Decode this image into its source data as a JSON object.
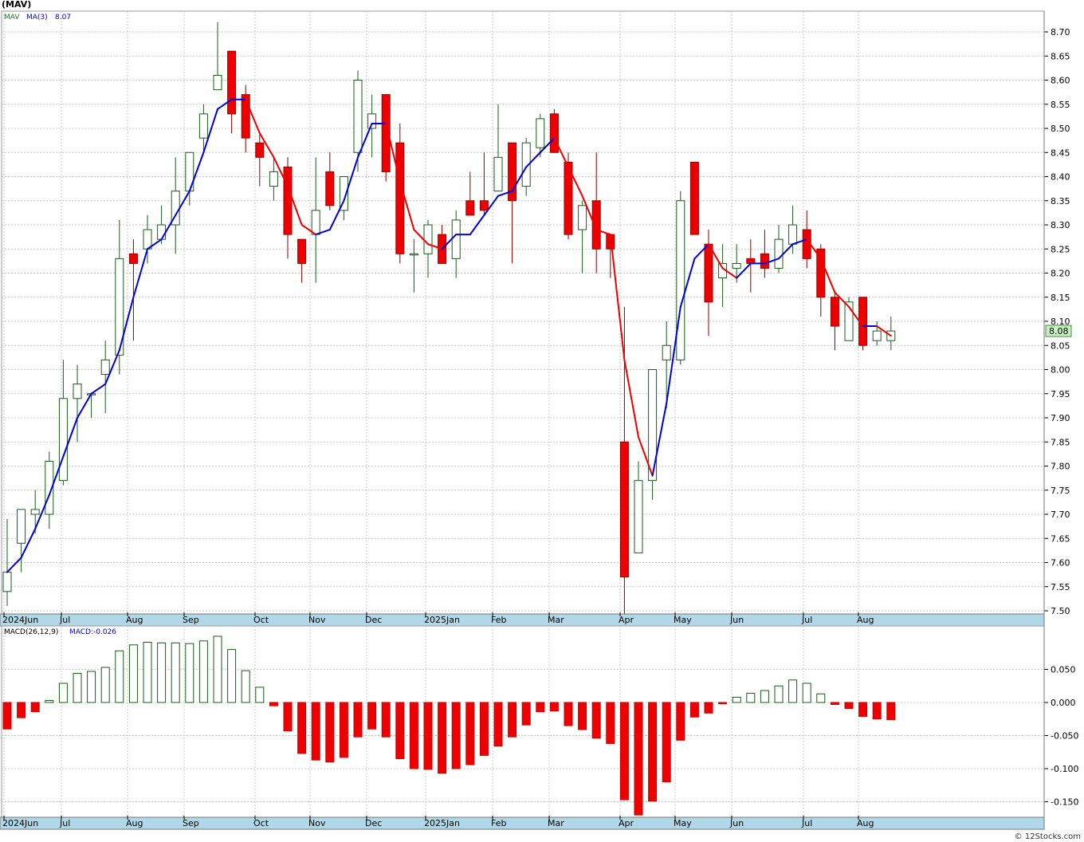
{
  "title": "(MAV)",
  "watermark": "© 12Stocks.com",
  "colors": {
    "up_stroke": "#1a5c1a",
    "down_fill": "#ee0000",
    "ma_up": "#0000dd",
    "ma_down": "#ee0000",
    "grid": "#c8c8c8",
    "axis_band": "#b0d8e8",
    "last_price_bg": "#c8f0c0"
  },
  "chart_data": [
    {
      "type": "candlestick",
      "panel": "price",
      "legend": {
        "symbol": "MAV",
        "ma_label": "MA(3)",
        "ma_value": "8.07"
      },
      "last_price_label": "8.08",
      "ylim": [
        7.485,
        8.735
      ],
      "y_ticks": [
        "8.70",
        "8.65",
        "8.60",
        "8.55",
        "8.50",
        "8.45",
        "8.40",
        "8.35",
        "8.30",
        "8.25",
        "8.20",
        "8.15",
        "8.10",
        "8.05",
        "8.00",
        "7.95",
        "7.90",
        "7.85",
        "7.80",
        "7.75",
        "7.70",
        "7.65",
        "7.60",
        "7.55",
        "7.50"
      ],
      "x_ticks": [
        "2024Jun",
        "Jul",
        "Aug",
        "Sep",
        "Oct",
        "Nov",
        "Dec",
        "2025Jan",
        "Feb",
        "Mar",
        "Apr",
        "May",
        "Jun",
        "Jul",
        "Aug"
      ],
      "candles": [
        {
          "o": 7.54,
          "h": 7.69,
          "l": 7.51,
          "c": 7.58
        },
        {
          "o": 7.64,
          "h": 7.71,
          "l": 7.58,
          "c": 7.71
        },
        {
          "o": 7.7,
          "h": 7.75,
          "l": 7.66,
          "c": 7.71
        },
        {
          "o": 7.7,
          "h": 7.83,
          "l": 7.67,
          "c": 7.81
        },
        {
          "o": 7.77,
          "h": 8.02,
          "l": 7.76,
          "c": 7.94
        },
        {
          "o": 7.94,
          "h": 8.01,
          "l": 7.85,
          "c": 7.97
        },
        {
          "o": 7.95,
          "h": 7.95,
          "l": 7.9,
          "c": 7.95
        },
        {
          "o": 7.99,
          "h": 8.06,
          "l": 7.91,
          "c": 8.02
        },
        {
          "o": 8.03,
          "h": 8.31,
          "l": 7.99,
          "c": 8.23
        },
        {
          "o": 8.24,
          "h": 8.27,
          "l": 8.06,
          "c": 8.22
        },
        {
          "o": 8.25,
          "h": 8.32,
          "l": 8.22,
          "c": 8.29
        },
        {
          "o": 8.27,
          "h": 8.34,
          "l": 8.26,
          "c": 8.3
        },
        {
          "o": 8.3,
          "h": 8.44,
          "l": 8.24,
          "c": 8.37
        },
        {
          "o": 8.37,
          "h": 8.45,
          "l": 8.34,
          "c": 8.45
        },
        {
          "o": 8.48,
          "h": 8.55,
          "l": 8.45,
          "c": 8.53
        },
        {
          "o": 8.58,
          "h": 8.72,
          "l": 8.58,
          "c": 8.61
        },
        {
          "o": 8.66,
          "h": 8.66,
          "l": 8.49,
          "c": 8.53
        },
        {
          "o": 8.57,
          "h": 8.59,
          "l": 8.45,
          "c": 8.48
        },
        {
          "o": 8.47,
          "h": 8.49,
          "l": 8.38,
          "c": 8.44
        },
        {
          "o": 8.38,
          "h": 8.44,
          "l": 8.35,
          "c": 8.41
        },
        {
          "o": 8.42,
          "h": 8.44,
          "l": 8.23,
          "c": 8.28
        },
        {
          "o": 8.27,
          "h": 8.27,
          "l": 8.18,
          "c": 8.22
        },
        {
          "o": 8.28,
          "h": 8.44,
          "l": 8.18,
          "c": 8.33
        },
        {
          "o": 8.41,
          "h": 8.45,
          "l": 8.33,
          "c": 8.34
        },
        {
          "o": 8.33,
          "h": 8.4,
          "l": 8.31,
          "c": 8.4
        },
        {
          "o": 8.45,
          "h": 8.62,
          "l": 8.41,
          "c": 8.6
        },
        {
          "o": 8.5,
          "h": 8.57,
          "l": 8.44,
          "c": 8.53
        },
        {
          "o": 8.57,
          "h": 8.57,
          "l": 8.39,
          "c": 8.41
        },
        {
          "o": 8.47,
          "h": 8.51,
          "l": 8.22,
          "c": 8.24
        },
        {
          "o": 8.24,
          "h": 8.27,
          "l": 8.16,
          "c": 8.24
        },
        {
          "o": 8.24,
          "h": 8.31,
          "l": 8.19,
          "c": 8.3
        },
        {
          "o": 8.28,
          "h": 8.3,
          "l": 8.22,
          "c": 8.22
        },
        {
          "o": 8.23,
          "h": 8.33,
          "l": 8.19,
          "c": 8.31
        },
        {
          "o": 8.35,
          "h": 8.41,
          "l": 8.32,
          "c": 8.32
        },
        {
          "o": 8.35,
          "h": 8.45,
          "l": 8.32,
          "c": 8.33
        },
        {
          "o": 8.37,
          "h": 8.55,
          "l": 8.37,
          "c": 8.44
        },
        {
          "o": 8.47,
          "h": 8.47,
          "l": 8.22,
          "c": 8.35
        },
        {
          "o": 8.38,
          "h": 8.48,
          "l": 8.36,
          "c": 8.47
        },
        {
          "o": 8.46,
          "h": 8.53,
          "l": 8.44,
          "c": 8.52
        },
        {
          "o": 8.53,
          "h": 8.54,
          "l": 8.45,
          "c": 8.45
        },
        {
          "o": 8.43,
          "h": 8.45,
          "l": 8.27,
          "c": 8.28
        },
        {
          "o": 8.29,
          "h": 8.35,
          "l": 8.2,
          "c": 8.34
        },
        {
          "o": 8.35,
          "h": 8.45,
          "l": 8.2,
          "c": 8.25
        },
        {
          "o": 8.28,
          "h": 8.28,
          "l": 8.19,
          "c": 8.25
        },
        {
          "o": 7.85,
          "h": 8.13,
          "l": 7.49,
          "c": 7.57
        },
        {
          "o": 7.62,
          "h": 7.81,
          "l": 7.62,
          "c": 7.77
        },
        {
          "o": 7.77,
          "h": 8.0,
          "l": 7.73,
          "c": 8.0
        },
        {
          "o": 8.02,
          "h": 8.1,
          "l": 7.92,
          "c": 8.05
        },
        {
          "o": 8.02,
          "h": 8.37,
          "l": 8.01,
          "c": 8.35
        },
        {
          "o": 8.43,
          "h": 8.43,
          "l": 8.28,
          "c": 8.28
        },
        {
          "o": 8.26,
          "h": 8.29,
          "l": 8.07,
          "c": 8.14
        },
        {
          "o": 8.19,
          "h": 8.26,
          "l": 8.13,
          "c": 8.22
        },
        {
          "o": 8.21,
          "h": 8.26,
          "l": 8.18,
          "c": 8.22
        },
        {
          "o": 8.23,
          "h": 8.27,
          "l": 8.16,
          "c": 8.22
        },
        {
          "o": 8.24,
          "h": 8.29,
          "l": 8.19,
          "c": 8.21
        },
        {
          "o": 8.21,
          "h": 8.3,
          "l": 8.2,
          "c": 8.27
        },
        {
          "o": 8.26,
          "h": 8.34,
          "l": 8.24,
          "c": 8.3
        },
        {
          "o": 8.29,
          "h": 8.33,
          "l": 8.21,
          "c": 8.23
        },
        {
          "o": 8.25,
          "h": 8.26,
          "l": 8.11,
          "c": 8.15
        },
        {
          "o": 8.15,
          "h": 8.16,
          "l": 8.04,
          "c": 8.09
        },
        {
          "o": 8.06,
          "h": 8.15,
          "l": 8.06,
          "c": 8.14
        },
        {
          "o": 8.15,
          "h": 8.15,
          "l": 8.04,
          "c": 8.05
        },
        {
          "o": 8.06,
          "h": 8.1,
          "l": 8.05,
          "c": 8.08
        },
        {
          "o": 8.06,
          "h": 8.11,
          "l": 8.04,
          "c": 8.08
        }
      ],
      "ma": [
        7.58,
        7.61,
        7.67,
        7.74,
        7.82,
        7.9,
        7.95,
        7.97,
        8.04,
        8.15,
        8.25,
        8.27,
        8.32,
        8.37,
        8.45,
        8.54,
        8.56,
        8.56,
        8.49,
        8.44,
        8.38,
        8.3,
        8.28,
        8.29,
        8.35,
        8.44,
        8.51,
        8.51,
        8.39,
        8.29,
        8.26,
        8.25,
        8.28,
        8.28,
        8.32,
        8.36,
        8.37,
        8.42,
        8.45,
        8.48,
        8.42,
        8.36,
        8.29,
        8.28,
        8.02,
        7.86,
        7.78,
        7.93,
        8.13,
        8.23,
        8.26,
        8.21,
        8.19,
        8.22,
        8.22,
        8.23,
        8.26,
        8.27,
        8.23,
        8.16,
        8.13,
        8.09,
        8.09,
        8.07
      ]
    },
    {
      "type": "bar",
      "panel": "macd",
      "legend": {
        "label": "MACD(26,12,9)",
        "value_label": "MACD:-0.026"
      },
      "ylim": [
        -0.177,
        0.113
      ],
      "y_ticks": [
        "0.050",
        "0.000",
        "-0.050",
        "-0.100",
        "-0.150"
      ],
      "x_ticks": [
        "2024Jun",
        "Jul",
        "Aug",
        "Sep",
        "Oct",
        "Nov",
        "Dec",
        "2025Jan",
        "Feb",
        "Mar",
        "Apr",
        "May",
        "Jun",
        "Jul",
        "Aug"
      ],
      "values": [
        -0.04,
        -0.023,
        -0.014,
        0.003,
        0.029,
        0.044,
        0.047,
        0.053,
        0.078,
        0.087,
        0.091,
        0.09,
        0.09,
        0.089,
        0.093,
        0.1,
        0.08,
        0.048,
        0.023,
        -0.005,
        -0.043,
        -0.077,
        -0.087,
        -0.09,
        -0.083,
        -0.052,
        -0.04,
        -0.052,
        -0.085,
        -0.1,
        -0.101,
        -0.107,
        -0.1,
        -0.094,
        -0.08,
        -0.066,
        -0.052,
        -0.034,
        -0.014,
        -0.013,
        -0.035,
        -0.041,
        -0.054,
        -0.062,
        -0.147,
        -0.17,
        -0.149,
        -0.12,
        -0.057,
        -0.022,
        -0.016,
        -0.002,
        0.008,
        0.014,
        0.018,
        0.025,
        0.034,
        0.029,
        0.013,
        -0.003,
        -0.009,
        -0.021,
        -0.025,
        -0.026
      ]
    }
  ]
}
